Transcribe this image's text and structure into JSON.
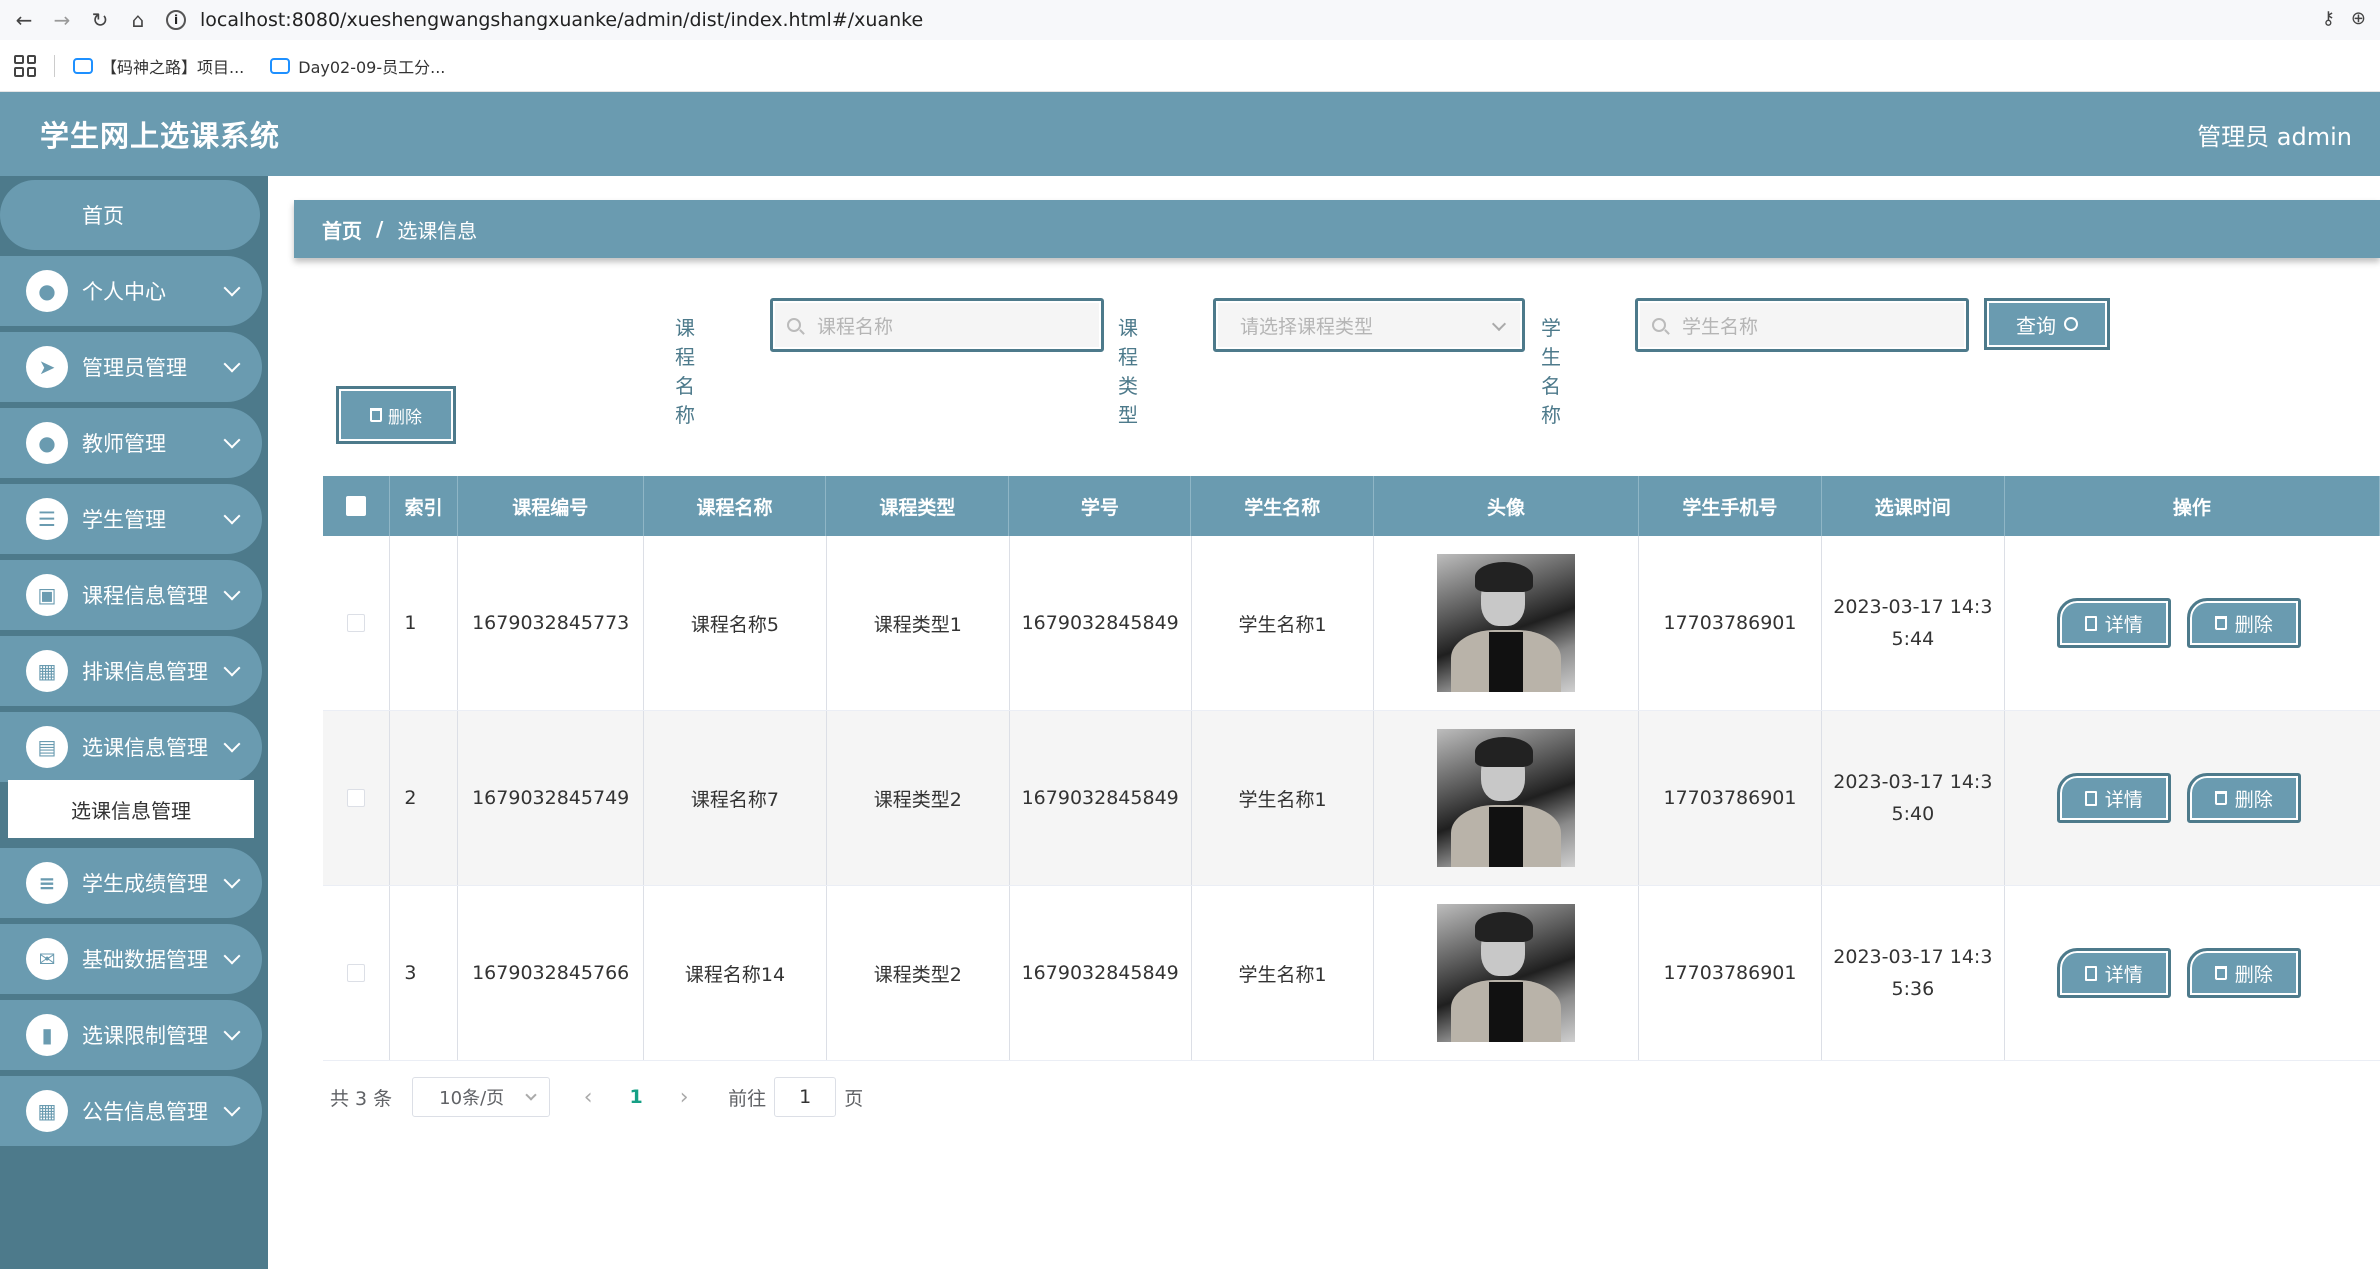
{
  "browser": {
    "url": "localhost:8080/xueshengwangshangxuanke/admin/dist/index.html#/xuanke",
    "bookmarks": [
      "【码神之路】项目...",
      "Day02-09-员工分..."
    ]
  },
  "header": {
    "title": "学生网上选课系统",
    "user": "管理员 admin"
  },
  "sidebar": {
    "home": "首页",
    "items": [
      {
        "label": "个人中心",
        "icon": "user-icon"
      },
      {
        "label": "管理员管理",
        "icon": "send-icon"
      },
      {
        "label": "教师管理",
        "icon": "user-icon"
      },
      {
        "label": "学生管理",
        "icon": "list-icon"
      },
      {
        "label": "课程信息管理",
        "icon": "briefcase-icon"
      },
      {
        "label": "排课信息管理",
        "icon": "grid-icon"
      },
      {
        "label": "选课信息管理",
        "icon": "clipboard-icon"
      },
      {
        "label": "学生成绩管理",
        "icon": "sliders-icon"
      },
      {
        "label": "基础数据管理",
        "icon": "chat-icon"
      },
      {
        "label": "选课限制管理",
        "icon": "book-icon"
      },
      {
        "label": "公告信息管理",
        "icon": "grid-icon"
      }
    ],
    "active_sub": "选课信息管理"
  },
  "breadcrumb": {
    "home": "首页",
    "sep": "/",
    "current": "选课信息"
  },
  "search": {
    "course_label": "课程名称",
    "course_placeholder": "课程名称",
    "type_label": "课程类型",
    "type_placeholder": "请选择课程类型",
    "student_label": "学生名称",
    "student_placeholder": "学生名称",
    "query": "查询"
  },
  "toolbar": {
    "delete": "删除"
  },
  "table": {
    "headers": [
      "索引",
      "课程编号",
      "课程名称",
      "课程类型",
      "学号",
      "学生名称",
      "头像",
      "学生手机号",
      "选课时间",
      "操作"
    ],
    "rows": [
      {
        "idx": "1",
        "code": "1679032845773",
        "name": "课程名称5",
        "type": "课程类型1",
        "sno": "1679032845849",
        "sname": "学生名称1",
        "phone": "17703786901",
        "time1": "2023-03-17 14:3",
        "time2": "5:44"
      },
      {
        "idx": "2",
        "code": "1679032845749",
        "name": "课程名称7",
        "type": "课程类型2",
        "sno": "1679032845849",
        "sname": "学生名称1",
        "phone": "17703786901",
        "time1": "2023-03-17 14:3",
        "time2": "5:40"
      },
      {
        "idx": "3",
        "code": "1679032845766",
        "name": "课程名称14",
        "type": "课程类型2",
        "sno": "1679032845849",
        "sname": "学生名称1",
        "phone": "17703786901",
        "time1": "2023-03-17 14:3",
        "time2": "5:36"
      }
    ],
    "detail_btn": "详情",
    "delete_btn": "删除"
  },
  "pager": {
    "total": "共 3 条",
    "size": "10条/页",
    "current": "1",
    "goto": "前往",
    "goto_value": "1",
    "page_unit": "页"
  },
  "colors": {
    "primary": "#6a9bb0",
    "sidebar_bg": "#4d7a8b",
    "page_active": "#16a085"
  }
}
